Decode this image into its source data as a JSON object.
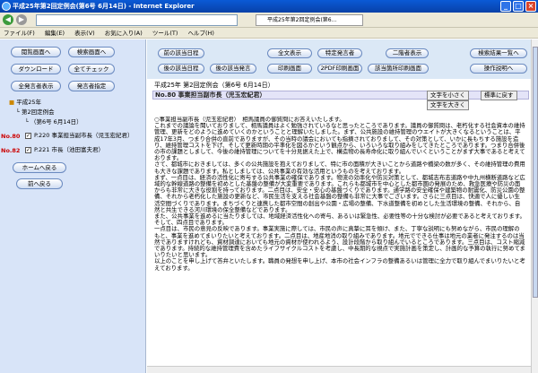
{
  "window": {
    "title": "平成25年第2回定例会(第6号 6月14日) - Internet Explorer",
    "tab_label": "平成25年第2回定例会(第6..."
  },
  "menubar": [
    "ファイル(F)",
    "編集(E)",
    "表示(V)",
    "お気に入り(A)",
    "ツール(T)",
    "ヘルプ(H)"
  ],
  "sidebar": {
    "buttons": {
      "select_all_minutes": "閲覧画面へ",
      "search_screen": "検索画面へ",
      "download": "ダウンロード",
      "check_all": "全てチェック",
      "full_text_display": "全発言者表示",
      "speaker_display": "発言者指定",
      "home": "ホームへ戻る",
      "back": "前へ戻る"
    },
    "tree": {
      "year": "平成25年",
      "session": "第2回定例会",
      "date": "（第6号 6月14日）"
    },
    "items": [
      {
        "no": "No.80",
        "text": "P.220 事業担当副市長（児玉宏紀君）"
      },
      {
        "no": "No.82",
        "text": "P.221 市長（池田富夫君）"
      }
    ]
  },
  "toolbar": {
    "row1": [
      "前の該当日程",
      "全文表示",
      "特定発言者",
      "二階者表示",
      "検索結果一覧へ"
    ],
    "row2": [
      "後の該当日程",
      "後の該当発言",
      "印刷画面",
      "2PDF印刷画面",
      "該当箇所印刷画面",
      "操作説明へ"
    ]
  },
  "main": {
    "session_title": "平成25年 第2回定例会（第6号 6月14日）",
    "speaker": "No.80 事業担当副市長（児玉宏紀君）",
    "font_small": "文字を小さく",
    "font_reset": "標準に戻す",
    "font_large": "文字を大きく",
    "paragraphs": [
      "○事業担当副市長（児玉宏紀君）　相馬議員の御質問にお答えいたします。",
      "これまでの議論を聞いておりまして、相馬議員はよく勉強されているなと思ったところであります。議員の御質問は、老朽化する社会資本の維持管理、更新をどのように進めていくのかということと理解いたしました。まず、公共施設の維持管理のウエイトが大きくなるということは、平成17年3月、つまり合併の直前でありますが、その当時の議会においても指摘されておりまして、その対策として、いかに長もちする施設を造り、維持管理コストを下げ、そして更新時期の平準化を図るかという観点から、いろいろな取り組みをしてきたところであります。つまり合併後の市の課題としまして、今後の維持管理についてを十分見据えた上で、構造物の長寿命化に取り組んでいくということがまず大事であると考えております。",
      "さて、都城市におきましては、多くの公共施設を抱えておりまして、特に市の面積が大きいことから道路や橋梁の数が多く、その維持管理の費用も大きな課題であります。私としましては、公共事業の有効な活用というものを考えております。",
      "まず、一点目は、経済の活性化に寄与する公共事業の確保であります。物流の効率化や防災対策として、都城志布志道路や中九州横断道路など広域的な幹線道路の整備を初めとした基盤の整備が大変重要であります。これらも都城市を中心とした都市圏の発展のため、救急医療や防災の面からも非常に大きな役割を持っております。二点目は、安全・安心の基盤づくりであります。通学路の安全確保や建築物の耐震化、防災公園の整備、それから老朽化した施設の更新など、市民生活を支える社会基盤の整備も非常に大事でございます。さらに三点目は、快適で人に優しい生活空間づくりであります。まちづくりと連携した都市空間の創出や公園・広場の整備、下水道整備を初めとした生活環境の整備、それから、自然と共生できる河川環境の保全整備などであります。",
      "また、公共事業を進めるに当たりましては、地域経済活性化への寄与、あるいは緊急性、必要性等の十分な検討が必要であると考えております。そして、四点目であります。",
      "一点目は、市民の意見の反映であります。事業実施に際しては、市民の声に真摯に耳を傾け、また、丁寧な説明にも努めながら、市民の理解のもと、事業を進めてまいりたいと考えております。二点目は、地産地消の取り組みであります。地元でできる仕事は地元の業者に発注するのは当然でありますけれども、資材調達においても地元の資材が使われるよう、設計段階から取り組んでいるところであります。三点目は、コスト縮減であります。持続的な維持管理費を含めたライフサイクルコストを考慮し、中長期的な視点で実施計画を策定し、計画的な予算の執行に努めてまいりたいと思います。",
      "以上のことを申し上げて答弁といたします。職員の発想を申し上げ、本市の社会インフラの整備あるいは管理に全力で取り組んでまいりたいと考えております。"
    ]
  }
}
